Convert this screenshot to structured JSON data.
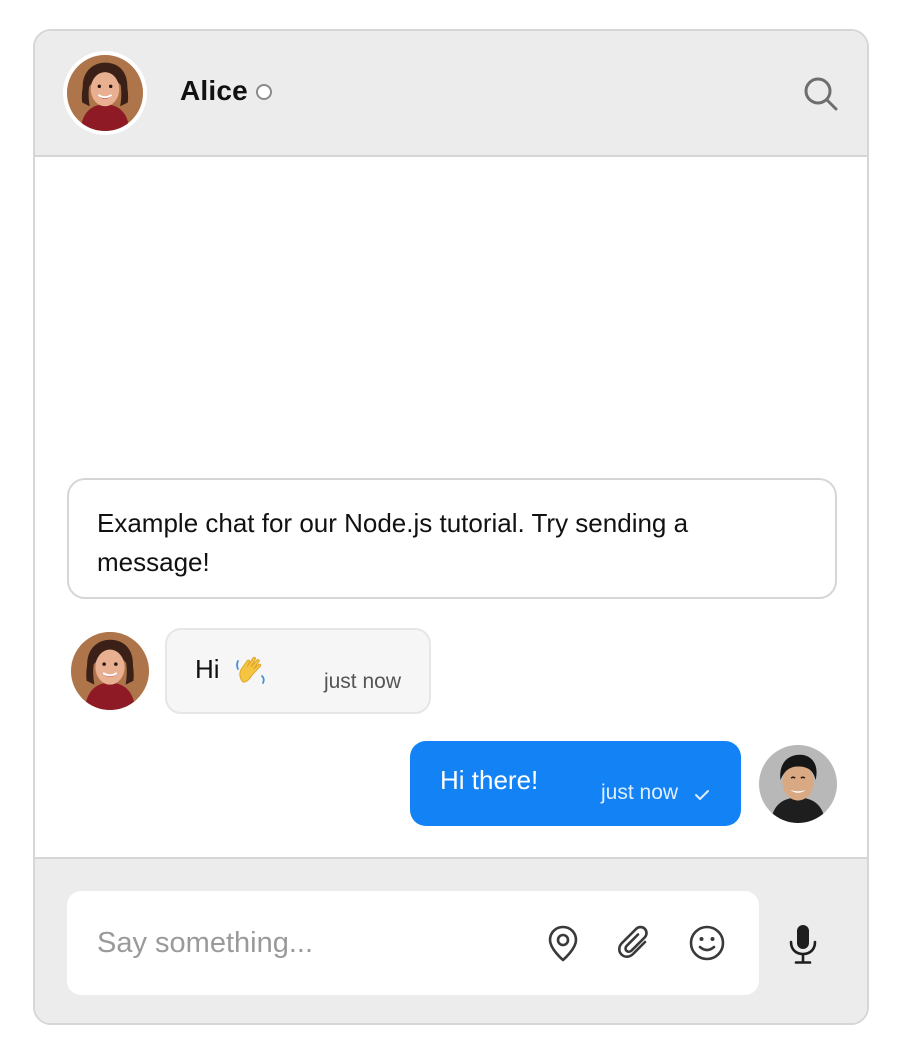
{
  "header": {
    "contact_name": "Alice",
    "status": "offline",
    "search_icon": "search-icon",
    "avatar_icon": "avatar-alice"
  },
  "messages": {
    "notice_text": "Example chat for our Node.js tutorial. Try sending a message!",
    "items": [
      {
        "direction": "incoming",
        "text": "Hi",
        "emoji": "waving-hand-icon",
        "time": "just now",
        "avatar": "avatar-alice"
      },
      {
        "direction": "outgoing",
        "text": "Hi there!",
        "time": "just now",
        "status_icon": "check-icon",
        "avatar": "avatar-user"
      }
    ]
  },
  "composer": {
    "placeholder": "Say something...",
    "value": "",
    "icons": [
      "location-pin-icon",
      "paperclip-icon",
      "smiley-icon",
      "microphone-icon"
    ]
  },
  "colors": {
    "accent": "#1282f5",
    "header_bg": "#ececec",
    "border": "#d6d6d6",
    "incoming_bubble": "#f6f6f6"
  }
}
